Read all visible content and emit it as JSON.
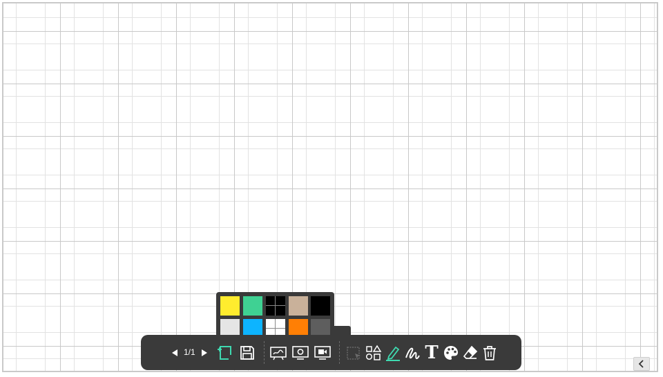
{
  "pager": {
    "label": "1/1",
    "prev_icon": "triangle-left-icon",
    "next_icon": "triangle-right-icon"
  },
  "palette": {
    "swatches": [
      {
        "name": "yellow",
        "color": "#ffec2e"
      },
      {
        "name": "green",
        "color": "#3fd193"
      },
      {
        "name": "black-grid",
        "color": "#000000"
      },
      {
        "name": "tan",
        "color": "#c9b19a"
      },
      {
        "name": "black",
        "color": "#000000"
      },
      {
        "name": "light-gray",
        "color": "#e5e5e5"
      },
      {
        "name": "sky-blue",
        "color": "#0db4ff"
      },
      {
        "name": "white-grid",
        "color": "#ffffff"
      },
      {
        "name": "orange",
        "color": "#ff7f05"
      },
      {
        "name": "dark-gray",
        "color": "#5e5e5e"
      }
    ]
  },
  "toolbar": {
    "tools": [
      {
        "name": "add-page",
        "icon": "add-page-icon",
        "active": true
      },
      {
        "name": "save",
        "icon": "save-icon",
        "active": false
      },
      {
        "name": "whiteboard",
        "icon": "whiteboard-icon",
        "active": false
      },
      {
        "name": "screenshot",
        "icon": "screen-capture-icon",
        "active": false
      },
      {
        "name": "screen-record",
        "icon": "screen-record-icon",
        "active": false
      },
      {
        "name": "select",
        "icon": "select-icon",
        "active": false
      },
      {
        "name": "shapes",
        "icon": "shapes-icon",
        "active": false
      },
      {
        "name": "pen",
        "icon": "pen-icon",
        "active": true
      },
      {
        "name": "brush",
        "icon": "brush-icon",
        "active": false
      },
      {
        "name": "text",
        "icon": "text-icon",
        "active": false
      },
      {
        "name": "color",
        "icon": "palette-icon",
        "active": false
      },
      {
        "name": "eraser",
        "icon": "eraser-icon",
        "active": false
      },
      {
        "name": "clear",
        "icon": "trash-icon",
        "active": false
      }
    ],
    "text_tool_glyph": "T",
    "accent_color": "#3fd9b0",
    "background_color": "#3a3a3a"
  },
  "collapse": {
    "icon": "chevron-left-icon"
  }
}
